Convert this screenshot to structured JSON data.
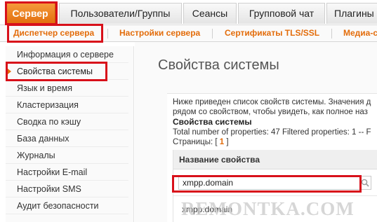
{
  "top_tabs": [
    {
      "label": "Сервер",
      "active": true
    },
    {
      "label": "Пользователи/Группы"
    },
    {
      "label": "Сеансы"
    },
    {
      "label": "Групповой чат"
    },
    {
      "label": "Плагины"
    }
  ],
  "sub_tabs": [
    {
      "label": "Диспетчер сервера",
      "active": true
    },
    {
      "label": "Настройки сервера"
    },
    {
      "label": "Сертификаты TLS/SSL"
    },
    {
      "label": "Медиа-с"
    }
  ],
  "sidebar": {
    "items": [
      {
        "label": "Информация о сервере"
      },
      {
        "label": "Свойства системы",
        "active": true
      },
      {
        "label": "Язык и время"
      },
      {
        "label": "Кластеризация"
      },
      {
        "label": "Сводка по кэшу"
      },
      {
        "label": "База данных"
      },
      {
        "label": "Журналы"
      },
      {
        "label": "Настройки E-mail"
      },
      {
        "label": "Настройки SMS"
      },
      {
        "label": "Аудит безопасности"
      }
    ]
  },
  "main": {
    "title": "Свойства системы",
    "description_line1": "Ниже приведен список свойств системы. Значения д",
    "description_line2": "рядом со свойством, чтобы увидеть, как полное наз",
    "section_title": "Свойства системы",
    "totals": "Total number of properties: 47 Filtered properties: 1 -- F",
    "pages_label": "Страницы: [",
    "pages_current": "1",
    "pages_suffix": "]",
    "table": {
      "column_header": "Название свойства",
      "filter_value": "xmpp.domain",
      "rows": [
        {
          "name": "xmpp.domain"
        }
      ]
    }
  },
  "watermark": "REMONTKA.COM",
  "colors": {
    "accent": "#e36c0a",
    "highlight_box": "#d8101a"
  },
  "icons": {
    "search": "search-icon",
    "active_marker": "triangle-right-icon"
  }
}
